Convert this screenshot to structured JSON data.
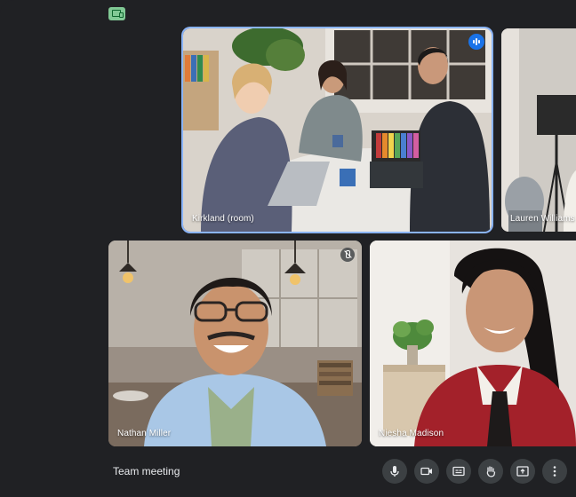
{
  "meeting": {
    "title": "Team meeting"
  },
  "tiles": [
    {
      "name": "Kirkland (room)",
      "state": "speaking"
    },
    {
      "name": "Lauren Williams"
    },
    {
      "name": "Nathan Miller",
      "state": "muted"
    },
    {
      "name": "Niesha Madison"
    }
  ],
  "controls": [
    {
      "icon": "mic-icon"
    },
    {
      "icon": "camera-icon"
    },
    {
      "icon": "captions-icon"
    },
    {
      "icon": "raise-hand-icon"
    },
    {
      "icon": "present-screen-icon"
    },
    {
      "icon": "more-options-icon"
    }
  ],
  "colors": {
    "background": "#202124",
    "active_border": "#8ab4f8",
    "speaking_badge": "#1a73e8",
    "control_button": "#3c4043"
  }
}
